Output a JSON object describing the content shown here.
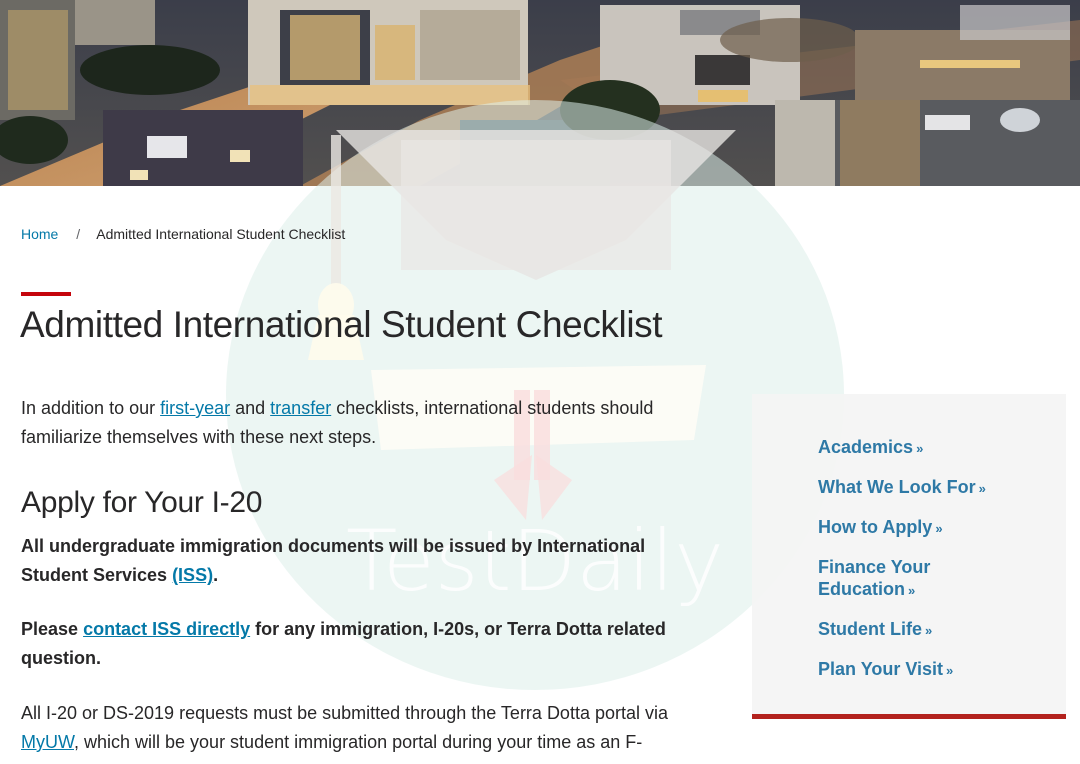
{
  "hero": {
    "image_alt": "Aerial night view of campus buildings and streets"
  },
  "watermark": {
    "text": "TestDaily",
    "icon": "graduation-cap-icon"
  },
  "breadcrumb": {
    "home": "Home",
    "separator": "/",
    "current": "Admitted International Student Checklist"
  },
  "page": {
    "title": "Admitted International Student Checklist",
    "intro": {
      "before": "In addition to our ",
      "link1": "first-year",
      "middle": " and ",
      "link2": "transfer",
      "after": " checklists, international students should familiarize themselves with these next steps."
    },
    "section": {
      "title": "Apply for Your I-20",
      "p1": {
        "before": "All undergraduate immigration documents will be issued by International Student Services ",
        "link": "(ISS)",
        "after": "."
      },
      "p2": {
        "before": "Please ",
        "link": "contact ISS directly",
        "after": " for any immigration, I-20s, or Terra Dotta related question."
      },
      "p3": {
        "before": "All I-20 or DS-2019 requests must be submitted through the Terra Dotta portal via ",
        "link": "MyUW",
        "after": ", which will be your student immigration portal during your time as an F-"
      }
    }
  },
  "sidebar": {
    "chevron": "»",
    "items": [
      {
        "label": "Academics"
      },
      {
        "label": "What We Look For"
      },
      {
        "label": "How to Apply"
      },
      {
        "label": "Finance Your Education"
      },
      {
        "label": "Student Life"
      },
      {
        "label": "Plan Your Visit"
      }
    ]
  },
  "colors": {
    "accent_red": "#c5050c",
    "link_blue": "#0479a8",
    "sidebar_link": "#2e79a6",
    "text": "#282728",
    "sidebar_bg": "#f4f4f4"
  }
}
